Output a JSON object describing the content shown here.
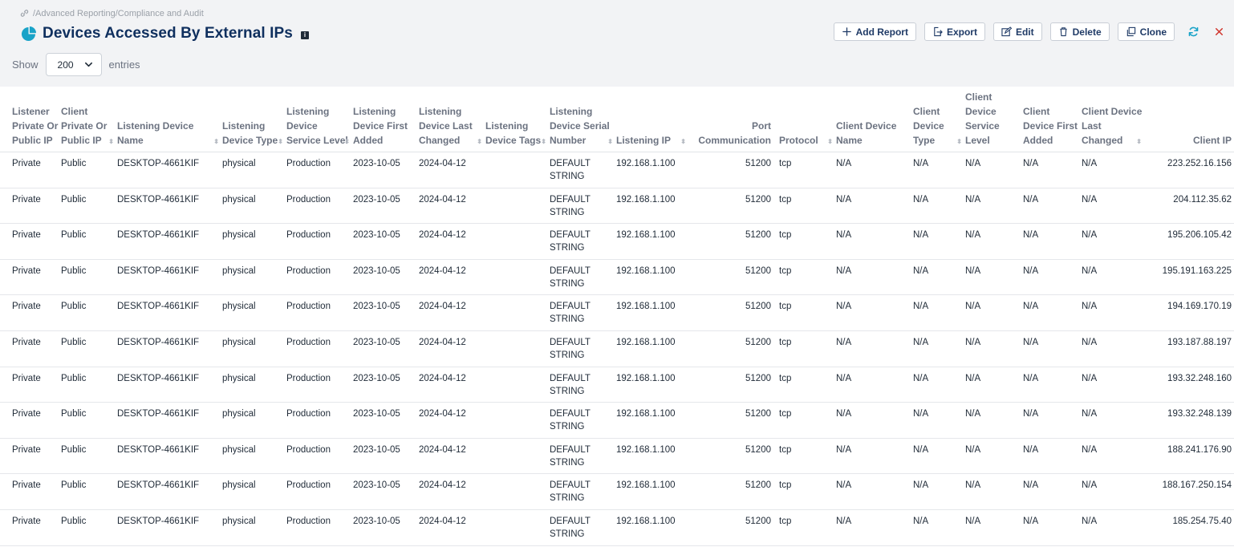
{
  "breadcrumb": "/Advanced Reporting/Compliance and Audit",
  "title": "Devices Accessed By External IPs",
  "toolbar": {
    "add_report": "Add Report",
    "export": "Export",
    "edit": "Edit",
    "delete": "Delete",
    "clone": "Clone"
  },
  "entries": {
    "show": "Show",
    "value": "200",
    "suffix": "entries"
  },
  "columns": [
    "Listener Private Or Public IP",
    "Client Private Or Public IP",
    "Listening Device Name",
    "Listening Device Type",
    "Listening Device Service Level",
    "Listening Device First Added",
    "Listening Device Last Changed",
    "Listening Device Tags",
    "Listening Device Serial Number",
    "Listening IP",
    "Port Communication",
    "Protocol",
    "Client Device Name",
    "Client Device Type",
    "Client Device Service Level",
    "Client Device First Added",
    "Client Device Last Changed",
    "Client IP"
  ],
  "rows": [
    [
      "Private",
      "Public",
      "DESKTOP-4661KIF",
      "physical",
      "Production",
      "2023-10-05",
      "2024-04-12",
      "",
      "DEFAULT STRING",
      "192.168.1.100",
      "51200",
      "tcp",
      "N/A",
      "N/A",
      "N/A",
      "N/A",
      "N/A",
      "223.252.16.156"
    ],
    [
      "Private",
      "Public",
      "DESKTOP-4661KIF",
      "physical",
      "Production",
      "2023-10-05",
      "2024-04-12",
      "",
      "DEFAULT STRING",
      "192.168.1.100",
      "51200",
      "tcp",
      "N/A",
      "N/A",
      "N/A",
      "N/A",
      "N/A",
      "204.112.35.62"
    ],
    [
      "Private",
      "Public",
      "DESKTOP-4661KIF",
      "physical",
      "Production",
      "2023-10-05",
      "2024-04-12",
      "",
      "DEFAULT STRING",
      "192.168.1.100",
      "51200",
      "tcp",
      "N/A",
      "N/A",
      "N/A",
      "N/A",
      "N/A",
      "195.206.105.42"
    ],
    [
      "Private",
      "Public",
      "DESKTOP-4661KIF",
      "physical",
      "Production",
      "2023-10-05",
      "2024-04-12",
      "",
      "DEFAULT STRING",
      "192.168.1.100",
      "51200",
      "tcp",
      "N/A",
      "N/A",
      "N/A",
      "N/A",
      "N/A",
      "195.191.163.225"
    ],
    [
      "Private",
      "Public",
      "DESKTOP-4661KIF",
      "physical",
      "Production",
      "2023-10-05",
      "2024-04-12",
      "",
      "DEFAULT STRING",
      "192.168.1.100",
      "51200",
      "tcp",
      "N/A",
      "N/A",
      "N/A",
      "N/A",
      "N/A",
      "194.169.170.19"
    ],
    [
      "Private",
      "Public",
      "DESKTOP-4661KIF",
      "physical",
      "Production",
      "2023-10-05",
      "2024-04-12",
      "",
      "DEFAULT STRING",
      "192.168.1.100",
      "51200",
      "tcp",
      "N/A",
      "N/A",
      "N/A",
      "N/A",
      "N/A",
      "193.187.88.197"
    ],
    [
      "Private",
      "Public",
      "DESKTOP-4661KIF",
      "physical",
      "Production",
      "2023-10-05",
      "2024-04-12",
      "",
      "DEFAULT STRING",
      "192.168.1.100",
      "51200",
      "tcp",
      "N/A",
      "N/A",
      "N/A",
      "N/A",
      "N/A",
      "193.32.248.160"
    ],
    [
      "Private",
      "Public",
      "DESKTOP-4661KIF",
      "physical",
      "Production",
      "2023-10-05",
      "2024-04-12",
      "",
      "DEFAULT STRING",
      "192.168.1.100",
      "51200",
      "tcp",
      "N/A",
      "N/A",
      "N/A",
      "N/A",
      "N/A",
      "193.32.248.139"
    ],
    [
      "Private",
      "Public",
      "DESKTOP-4661KIF",
      "physical",
      "Production",
      "2023-10-05",
      "2024-04-12",
      "",
      "DEFAULT STRING",
      "192.168.1.100",
      "51200",
      "tcp",
      "N/A",
      "N/A",
      "N/A",
      "N/A",
      "N/A",
      "188.241.176.90"
    ],
    [
      "Private",
      "Public",
      "DESKTOP-4661KIF",
      "physical",
      "Production",
      "2023-10-05",
      "2024-04-12",
      "",
      "DEFAULT STRING",
      "192.168.1.100",
      "51200",
      "tcp",
      "N/A",
      "N/A",
      "N/A",
      "N/A",
      "N/A",
      "188.167.250.154"
    ],
    [
      "Private",
      "Public",
      "DESKTOP-4661KIF",
      "physical",
      "Production",
      "2023-10-05",
      "2024-04-12",
      "",
      "DEFAULT STRING",
      "192.168.1.100",
      "51200",
      "tcp",
      "N/A",
      "N/A",
      "N/A",
      "N/A",
      "N/A",
      "185.254.75.40"
    ]
  ],
  "colors": {
    "title": "#0f2f5e",
    "accent": "#1aa3c8",
    "close": "#d0342c",
    "refresh": "#1aa3c8"
  }
}
